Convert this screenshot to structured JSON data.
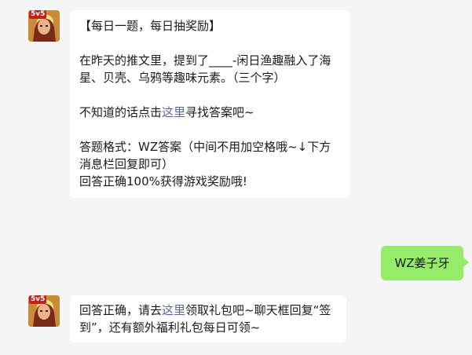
{
  "messages": [
    {
      "sender": "bot",
      "avatar_icon": "hero-avatar-icon",
      "avatar_badge": "5v5",
      "lines": {
        "title": "【每日一题，每日抽奖励】",
        "question": "在昨天的推文里，提到了____-闲日渔趣融入了海星、贝壳、乌鸦等趣味元素。（三个字）",
        "hint_prefix": "不知道的话点击",
        "hint_link": "这里",
        "hint_suffix": "寻找答案吧~",
        "format_line1": "答题格式：WZ答案（中间不用加空格哦~↓下方消息栏回复即可）",
        "format_line2": "回答正确100%获得游戏奖励哦!"
      }
    },
    {
      "sender": "user",
      "text": "WZ姜子牙"
    },
    {
      "sender": "bot",
      "avatar_icon": "hero-avatar-icon",
      "avatar_badge": "5v5",
      "lines": {
        "prefix": "回答正确，请去",
        "link": "这里",
        "suffix": "领取礼包吧~聊天框回复“签到”，还有额外福利礼包每日可领~"
      }
    }
  ],
  "colors": {
    "background": "#f5f5f5",
    "bot_bubble": "#ffffff",
    "user_bubble": "#95ec69",
    "link": "#576b95"
  }
}
